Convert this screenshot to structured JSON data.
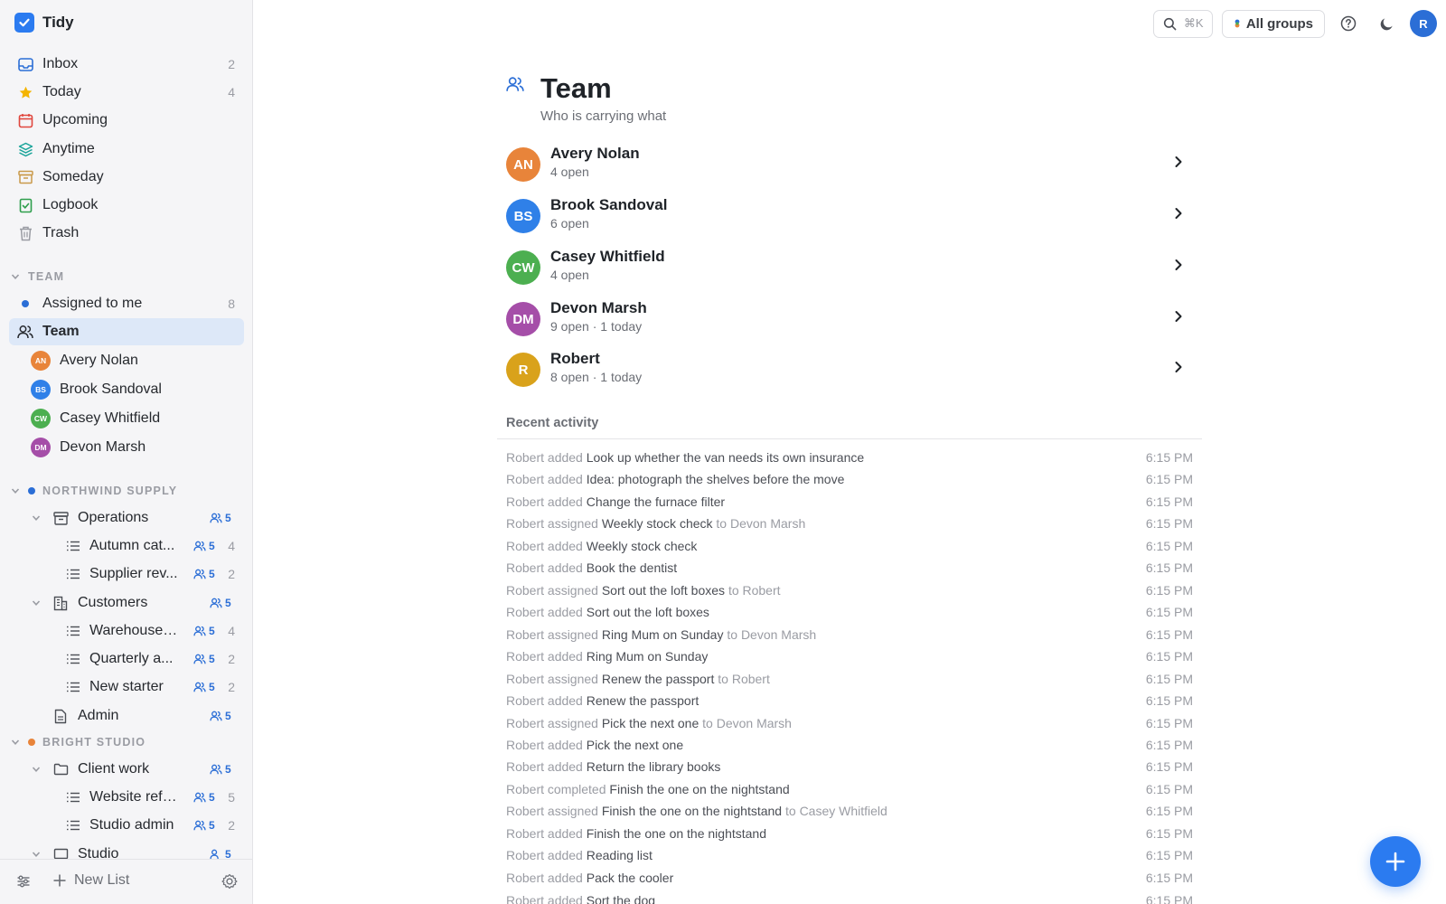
{
  "app": {
    "name": "Tidy"
  },
  "sidebar": {
    "nav": [
      {
        "label": "Inbox",
        "count": "2",
        "icon": "inbox-icon"
      },
      {
        "label": "Today",
        "count": "4",
        "icon": "star-icon"
      },
      {
        "label": "Upcoming",
        "count": "",
        "icon": "calendar-icon"
      },
      {
        "label": "Anytime",
        "count": "",
        "icon": "layers-icon"
      },
      {
        "label": "Someday",
        "count": "",
        "icon": "archive-box-icon"
      },
      {
        "label": "Logbook",
        "count": "",
        "icon": "logbook-icon"
      },
      {
        "label": "Trash",
        "count": "",
        "icon": "trash-icon"
      }
    ],
    "team_section": {
      "title": "TEAM",
      "assigned": {
        "label": "Assigned to me",
        "count": "8"
      },
      "team": {
        "label": "Team"
      },
      "members": [
        {
          "initials": "AN",
          "name": "Avery Nolan",
          "color": "#e8843a"
        },
        {
          "initials": "BS",
          "name": "Brook Sandoval",
          "color": "#2f80e8"
        },
        {
          "initials": "CW",
          "name": "Casey Whitfield",
          "color": "#4caf50"
        },
        {
          "initials": "DM",
          "name": "Devon Marsh",
          "color": "#a54ea8"
        }
      ]
    },
    "groups": [
      {
        "title": "NORTHWIND SUPPLY",
        "dot_color": "#2b6ed6",
        "areas": [
          {
            "label": "Operations",
            "share": "5",
            "lists": [
              {
                "label": "Autumn cat...",
                "share": "5",
                "count": "4"
              },
              {
                "label": "Supplier rev...",
                "share": "5",
                "count": "2"
              }
            ]
          },
          {
            "label": "Customers",
            "share": "5",
            "lists": [
              {
                "label": "Warehouse ...",
                "share": "5",
                "count": "4"
              },
              {
                "label": "Quarterly a...",
                "share": "5",
                "count": "2"
              },
              {
                "label": "New starter",
                "share": "5",
                "count": "2"
              }
            ]
          },
          {
            "label": "Admin",
            "share": "5",
            "lists": []
          }
        ]
      },
      {
        "title": "BRIGHT STUDIO",
        "dot_color": "#e8843a",
        "areas": [
          {
            "label": "Client work",
            "share": "5",
            "lists": [
              {
                "label": "Website refr...",
                "share": "5",
                "count": "5"
              },
              {
                "label": "Studio admin",
                "share": "5",
                "count": "2"
              }
            ]
          },
          {
            "label": "Studio",
            "share": "5",
            "lists": []
          }
        ]
      }
    ],
    "footer": {
      "new_list": "New List"
    }
  },
  "topbar": {
    "search_shortcut": "⌘K",
    "groups_label": "All groups",
    "user_initial": "R"
  },
  "page": {
    "title": "Team",
    "subtitle": "Who is carrying what",
    "members": [
      {
        "initials": "AN",
        "name": "Avery Nolan",
        "status": "4 open",
        "color": "#e8843a"
      },
      {
        "initials": "BS",
        "name": "Brook Sandoval",
        "status": "6 open",
        "color": "#2f80e8"
      },
      {
        "initials": "CW",
        "name": "Casey Whitfield",
        "status": "4 open",
        "color": "#4caf50"
      },
      {
        "initials": "DM",
        "name": "Devon Marsh",
        "status": "9 open · 1 today",
        "color": "#a54ea8"
      },
      {
        "initials": "R",
        "name": "Robert",
        "status": "8 open · 1 today",
        "color": "#d9a21b"
      }
    ],
    "recent_title": "Recent activity",
    "activity": [
      {
        "actor": "Robert added",
        "item": "Look up whether the van needs its own insurance",
        "target": "",
        "time": "6:15 PM"
      },
      {
        "actor": "Robert added",
        "item": "Idea: photograph the shelves before the move",
        "target": "",
        "time": "6:15 PM"
      },
      {
        "actor": "Robert added",
        "item": "Change the furnace filter",
        "target": "",
        "time": "6:15 PM"
      },
      {
        "actor": "Robert assigned",
        "item": "Weekly stock check",
        "target": "to Devon Marsh",
        "time": "6:15 PM"
      },
      {
        "actor": "Robert added",
        "item": "Weekly stock check",
        "target": "",
        "time": "6:15 PM"
      },
      {
        "actor": "Robert added",
        "item": "Book the dentist",
        "target": "",
        "time": "6:15 PM"
      },
      {
        "actor": "Robert assigned",
        "item": "Sort out the loft boxes",
        "target": "to Robert",
        "time": "6:15 PM"
      },
      {
        "actor": "Robert added",
        "item": "Sort out the loft boxes",
        "target": "",
        "time": "6:15 PM"
      },
      {
        "actor": "Robert assigned",
        "item": "Ring Mum on Sunday",
        "target": "to Devon Marsh",
        "time": "6:15 PM"
      },
      {
        "actor": "Robert added",
        "item": "Ring Mum on Sunday",
        "target": "",
        "time": "6:15 PM"
      },
      {
        "actor": "Robert assigned",
        "item": "Renew the passport",
        "target": "to Robert",
        "time": "6:15 PM"
      },
      {
        "actor": "Robert added",
        "item": "Renew the passport",
        "target": "",
        "time": "6:15 PM"
      },
      {
        "actor": "Robert assigned",
        "item": "Pick the next one",
        "target": "to Devon Marsh",
        "time": "6:15 PM"
      },
      {
        "actor": "Robert added",
        "item": "Pick the next one",
        "target": "",
        "time": "6:15 PM"
      },
      {
        "actor": "Robert added",
        "item": "Return the library books",
        "target": "",
        "time": "6:15 PM"
      },
      {
        "actor": "Robert completed",
        "item": "Finish the one on the nightstand",
        "target": "",
        "time": "6:15 PM"
      },
      {
        "actor": "Robert assigned",
        "item": "Finish the one on the nightstand",
        "target": "to Casey Whitfield",
        "time": "6:15 PM"
      },
      {
        "actor": "Robert added",
        "item": "Finish the one on the nightstand",
        "target": "",
        "time": "6:15 PM"
      },
      {
        "actor": "Robert added",
        "item": "Reading list",
        "target": "",
        "time": "6:15 PM"
      },
      {
        "actor": "Robert added",
        "item": "Pack the cooler",
        "target": "",
        "time": "6:15 PM"
      },
      {
        "actor": "Robert added",
        "item": "Sort the dog",
        "target": "",
        "time": "6:15 PM"
      }
    ]
  }
}
